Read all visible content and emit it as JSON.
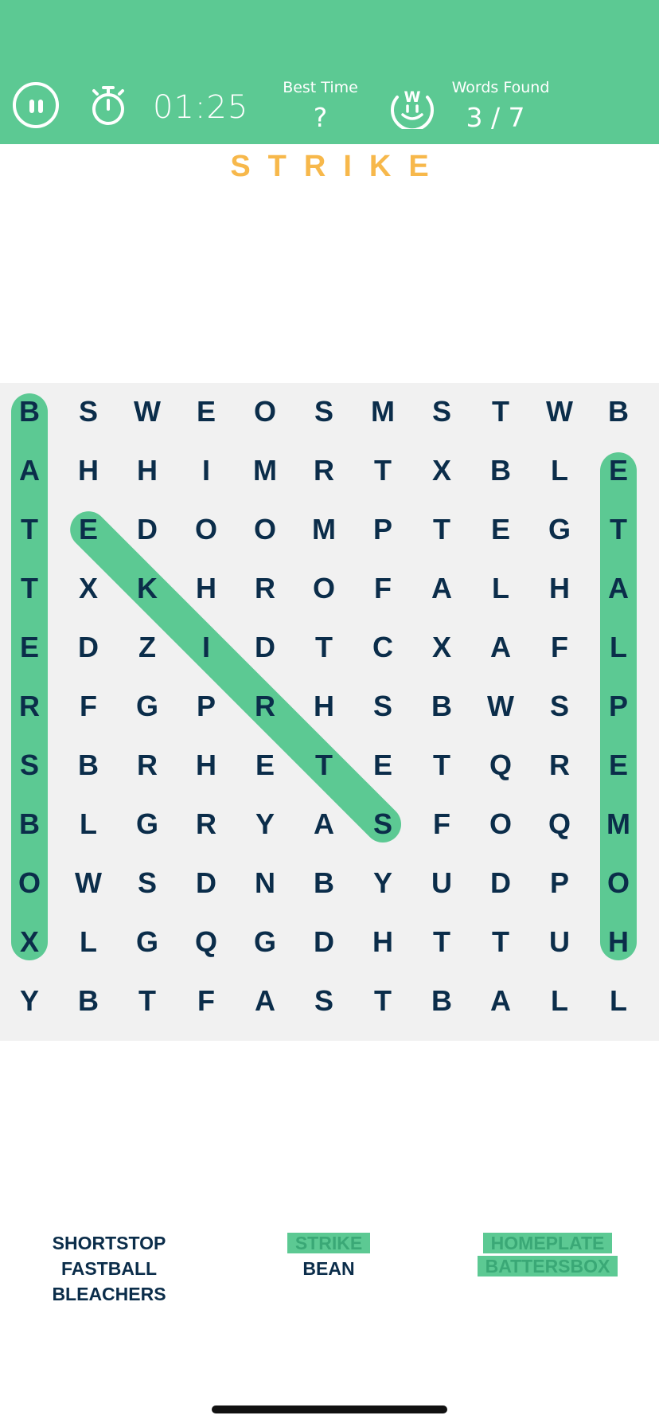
{
  "colors": {
    "accent": "#5cc993",
    "title_orange": "#f7b84b",
    "letter": "#0b2d4a",
    "board_bg": "#f1f1f1"
  },
  "header": {
    "pause_icon": "pause-icon",
    "stopwatch_icon": "stopwatch-icon",
    "timer": "01:25",
    "best_time_label": "Best Time",
    "best_time_value": "?",
    "logo_icon": "w-smiley-icon",
    "words_found_label": "Words Found",
    "words_found_value": "3 / 7"
  },
  "current_word": "STRIKE",
  "grid": [
    [
      "B",
      "S",
      "W",
      "E",
      "O",
      "S",
      "M",
      "S",
      "T",
      "W",
      "B"
    ],
    [
      "A",
      "H",
      "H",
      "I",
      "M",
      "R",
      "T",
      "X",
      "B",
      "L",
      "E"
    ],
    [
      "T",
      "E",
      "D",
      "O",
      "O",
      "M",
      "P",
      "T",
      "E",
      "G",
      "T"
    ],
    [
      "T",
      "X",
      "K",
      "H",
      "R",
      "O",
      "F",
      "A",
      "L",
      "H",
      "A"
    ],
    [
      "E",
      "D",
      "Z",
      "I",
      "D",
      "T",
      "C",
      "X",
      "A",
      "F",
      "L"
    ],
    [
      "R",
      "F",
      "G",
      "P",
      "R",
      "H",
      "S",
      "B",
      "W",
      "S",
      "P"
    ],
    [
      "S",
      "B",
      "R",
      "H",
      "E",
      "T",
      "E",
      "T",
      "Q",
      "R",
      "E"
    ],
    [
      "B",
      "L",
      "G",
      "R",
      "Y",
      "A",
      "S",
      "F",
      "O",
      "Q",
      "M"
    ],
    [
      "O",
      "W",
      "S",
      "D",
      "N",
      "B",
      "Y",
      "U",
      "D",
      "P",
      "O"
    ],
    [
      "X",
      "L",
      "G",
      "Q",
      "G",
      "D",
      "H",
      "T",
      "T",
      "U",
      "H"
    ],
    [
      "Y",
      "B",
      "T",
      "F",
      "A",
      "S",
      "T",
      "B",
      "A",
      "L",
      "L"
    ]
  ],
  "found_paths": [
    {
      "word": "BATTERSBOX",
      "start": [
        0,
        0
      ],
      "end": [
        9,
        0
      ]
    },
    {
      "word": "STRIKE",
      "start": [
        7,
        6
      ],
      "end": [
        2,
        1
      ]
    },
    {
      "word": "HOMEPLATE",
      "start": [
        9,
        10
      ],
      "end": [
        1,
        10
      ]
    }
  ],
  "word_list": {
    "columns": [
      [
        {
          "label": "SHORTSTOP",
          "found": false
        },
        {
          "label": "FASTBALL",
          "found": false
        },
        {
          "label": "BLEACHERS",
          "found": false
        }
      ],
      [
        {
          "label": "STRIKE",
          "found": true
        },
        {
          "label": "BEAN",
          "found": false
        }
      ],
      [
        {
          "label": "HOMEPLATE",
          "found": true
        },
        {
          "label": "BATTERSBOX",
          "found": true
        }
      ]
    ]
  }
}
